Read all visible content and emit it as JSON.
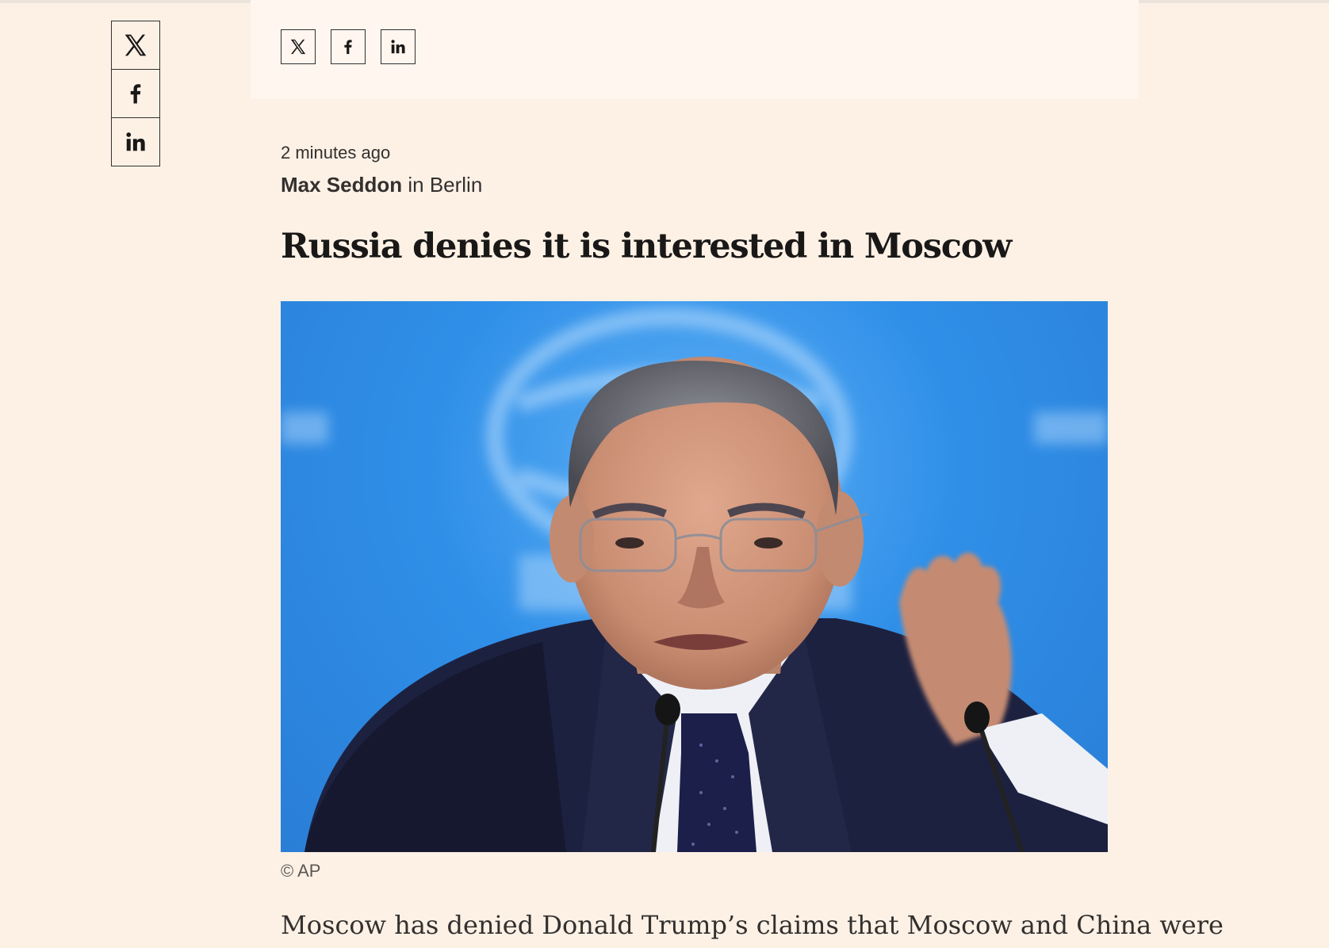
{
  "share": {
    "rail": [
      {
        "network": "X",
        "icon": "x-logo-icon"
      },
      {
        "network": "Facebook",
        "icon": "facebook-logo-icon"
      },
      {
        "network": "LinkedIn",
        "icon": "linkedin-logo-icon"
      }
    ],
    "bar": [
      {
        "network": "X",
        "icon": "x-logo-icon"
      },
      {
        "network": "Facebook",
        "icon": "facebook-logo-icon"
      },
      {
        "network": "LinkedIn",
        "icon": "linkedin-logo-icon"
      }
    ]
  },
  "post": {
    "timestamp": "2 minutes ago",
    "author": "Max Seddon",
    "location": " in Berlin",
    "headline": "Russia denies it is interested in Moscow",
    "image_caption": "© AP",
    "lede": "Moscow has denied Donald Trump’s claims that Moscow and China were"
  },
  "colors": {
    "page_background": "#fdf1e6",
    "panel_background": "#fef6ef",
    "text": "#33302e",
    "photo_backdrop": "#2f8fe8"
  }
}
